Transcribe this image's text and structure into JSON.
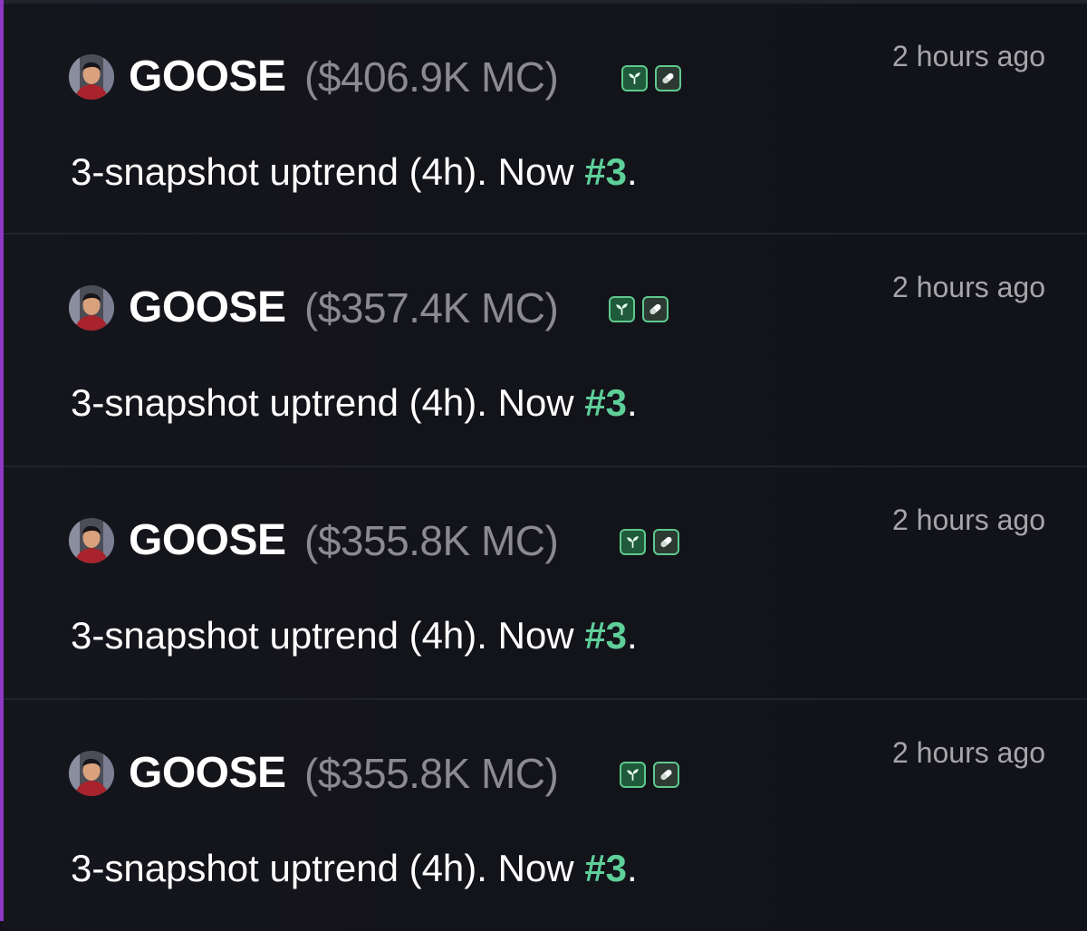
{
  "feed": {
    "items": [
      {
        "token": "GOOSE",
        "market_cap": "($406.9K MC)",
        "time": "2 hours ago",
        "message_prefix": "3-snapshot uptrend (4h). Now ",
        "rank": "#3",
        "message_suffix": "."
      },
      {
        "token": "GOOSE",
        "market_cap": "($357.4K MC)",
        "time": "2 hours ago",
        "message_prefix": "3-snapshot uptrend (4h). Now ",
        "rank": "#3",
        "message_suffix": "."
      },
      {
        "token": "GOOSE",
        "market_cap": "($355.8K MC)",
        "time": "2 hours ago",
        "message_prefix": "3-snapshot uptrend (4h). Now ",
        "rank": "#3",
        "message_suffix": "."
      },
      {
        "token": "GOOSE",
        "market_cap": "($355.8K MC)",
        "time": "2 hours ago",
        "message_prefix": "3-snapshot uptrend (4h). Now ",
        "rank": "#3",
        "message_suffix": "."
      }
    ],
    "badges": [
      "sprout-icon",
      "pill-icon"
    ]
  },
  "colors": {
    "accent": "#8e37c4",
    "rank": "#5fcf9a",
    "badge_border": "#5fc88e",
    "background": "#121319"
  }
}
